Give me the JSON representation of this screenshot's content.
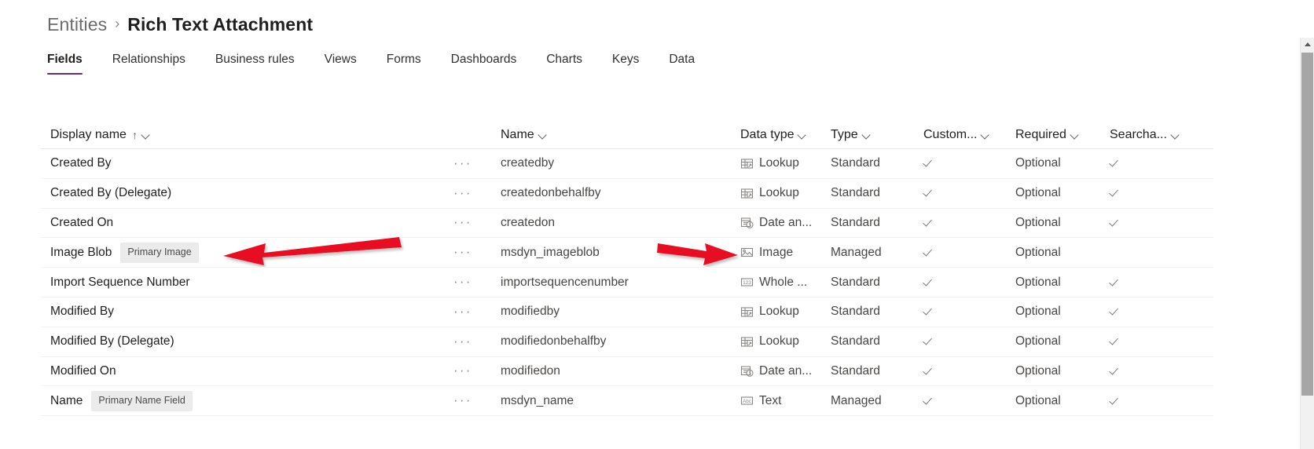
{
  "breadcrumb": {
    "parent": "Entities",
    "separator": "›",
    "current": "Rich Text Attachment"
  },
  "tabs": [
    {
      "label": "Fields",
      "active": true
    },
    {
      "label": "Relationships",
      "active": false
    },
    {
      "label": "Business rules",
      "active": false
    },
    {
      "label": "Views",
      "active": false
    },
    {
      "label": "Forms",
      "active": false
    },
    {
      "label": "Dashboards",
      "active": false
    },
    {
      "label": "Charts",
      "active": false
    },
    {
      "label": "Keys",
      "active": false
    },
    {
      "label": "Data",
      "active": false
    }
  ],
  "table": {
    "columns": [
      {
        "key": "display_name",
        "label": "Display name",
        "sorted": "ascending",
        "sort_glyph": "↑"
      },
      {
        "key": "name",
        "label": "Name"
      },
      {
        "key": "data_type",
        "label": "Data type"
      },
      {
        "key": "type",
        "label": "Type"
      },
      {
        "key": "custom",
        "label": "Custom..."
      },
      {
        "key": "required",
        "label": "Required"
      },
      {
        "key": "searchable",
        "label": "Searcha..."
      }
    ],
    "row_menu_glyph": "···",
    "rows": [
      {
        "display_name": "Created By",
        "badge": null,
        "name": "createdby",
        "data_type": "Lookup",
        "data_type_icon": "lookup-icon",
        "type": "Standard",
        "custom": true,
        "required": "Optional",
        "searchable": true
      },
      {
        "display_name": "Created By (Delegate)",
        "badge": null,
        "name": "createdonbehalfby",
        "data_type": "Lookup",
        "data_type_icon": "lookup-icon",
        "type": "Standard",
        "custom": true,
        "required": "Optional",
        "searchable": true
      },
      {
        "display_name": "Created On",
        "badge": null,
        "name": "createdon",
        "data_type": "Date an...",
        "data_type_icon": "date-time-icon",
        "type": "Standard",
        "custom": true,
        "required": "Optional",
        "searchable": true
      },
      {
        "display_name": "Image Blob",
        "badge": "Primary Image",
        "name": "msdyn_imageblob",
        "data_type": "Image",
        "data_type_icon": "image-icon",
        "type": "Managed",
        "custom": true,
        "required": "Optional",
        "searchable": false
      },
      {
        "display_name": "Import Sequence Number",
        "badge": null,
        "name": "importsequencenumber",
        "data_type": "Whole ...",
        "data_type_icon": "whole-number-icon",
        "type": "Standard",
        "custom": true,
        "required": "Optional",
        "searchable": true
      },
      {
        "display_name": "Modified By",
        "badge": null,
        "name": "modifiedby",
        "data_type": "Lookup",
        "data_type_icon": "lookup-icon",
        "type": "Standard",
        "custom": true,
        "required": "Optional",
        "searchable": true
      },
      {
        "display_name": "Modified By (Delegate)",
        "badge": null,
        "name": "modifiedonbehalfby",
        "data_type": "Lookup",
        "data_type_icon": "lookup-icon",
        "type": "Standard",
        "custom": true,
        "required": "Optional",
        "searchable": true
      },
      {
        "display_name": "Modified On",
        "badge": null,
        "name": "modifiedon",
        "data_type": "Date an...",
        "data_type_icon": "date-time-icon",
        "type": "Standard",
        "custom": true,
        "required": "Optional",
        "searchable": true
      },
      {
        "display_name": "Name",
        "badge": "Primary Name Field",
        "name": "msdyn_name",
        "data_type": "Text",
        "data_type_icon": "text-icon",
        "type": "Managed",
        "custom": true,
        "required": "Optional",
        "searchable": true
      }
    ]
  },
  "annotations": [
    {
      "name": "arrow-left-to-image-blob-display-name",
      "direction": "left",
      "color": "#e81123"
    },
    {
      "name": "arrow-right-to-image-data-type",
      "direction": "right",
      "color": "#e81123"
    }
  ],
  "colors": {
    "accent": "#6b2c6b",
    "annotation_red": "#e81123",
    "badge_bg": "#ebebeb",
    "text_primary": "#201f1e",
    "text_secondary": "#484644"
  },
  "scrollbar": {
    "up_arrow": "scroll-up-arrow"
  }
}
